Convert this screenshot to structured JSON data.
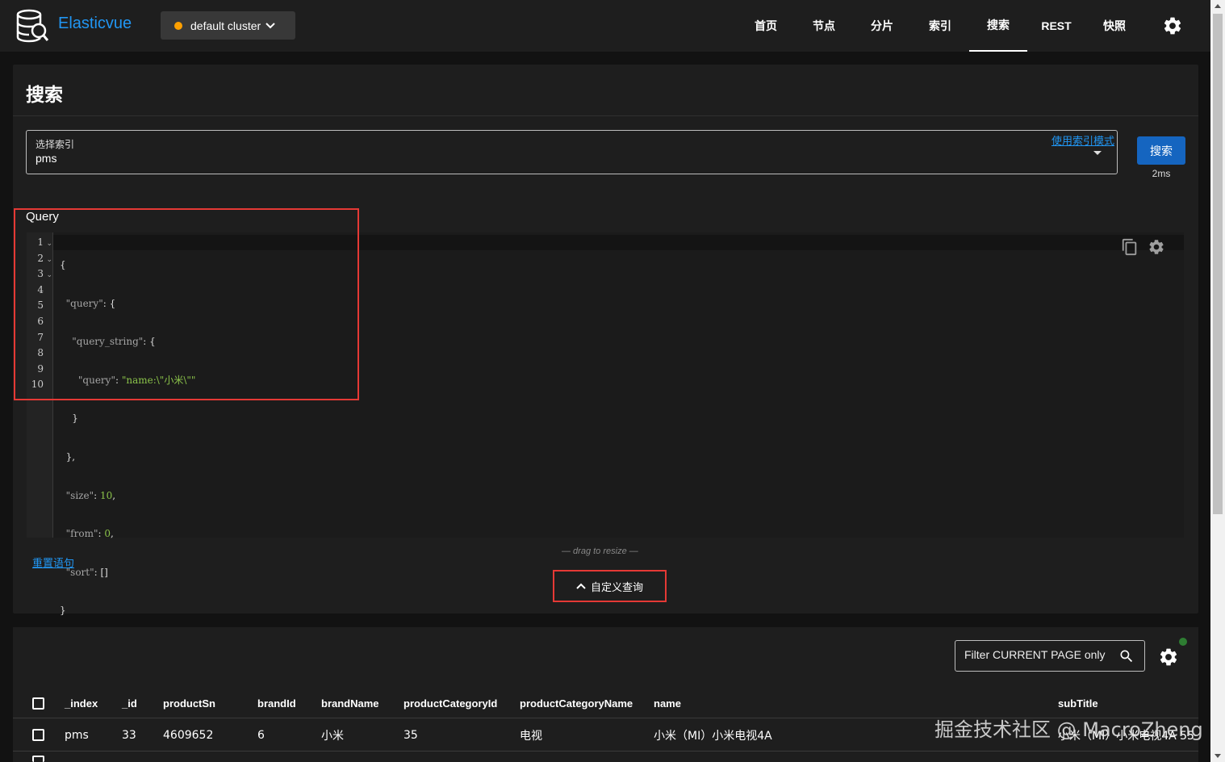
{
  "app": {
    "brand": "Elasticvue"
  },
  "cluster": {
    "label": "default cluster",
    "status_color": "#ffa000"
  },
  "nav": {
    "items": [
      {
        "label": "首页"
      },
      {
        "label": "节点"
      },
      {
        "label": "分片"
      },
      {
        "label": "索引"
      },
      {
        "label": "搜索",
        "active": true
      },
      {
        "label": "REST"
      },
      {
        "label": "快照"
      }
    ]
  },
  "search": {
    "title": "搜索",
    "index_label": "选择索引",
    "index_value": "pms",
    "index_pattern_link": "使用索引模式",
    "button": "搜索",
    "time": "2ms",
    "query_label": "Query",
    "drag_hint": "— drag to resize —",
    "reset_link": "重置语句",
    "custom_query_button": "自定义查询"
  },
  "editor": {
    "line_numbers": [
      "1",
      "2",
      "3",
      "4",
      "5",
      "6",
      "7",
      "8",
      "9",
      "10"
    ]
  },
  "results": {
    "filter_placeholder": "Filter CURRENT PAGE only",
    "columns": [
      "_index",
      "_id",
      "productSn",
      "brandId",
      "brandName",
      "productCategoryId",
      "productCategoryName",
      "name",
      "subTitle"
    ],
    "rows": [
      {
        "_index": "pms",
        "_id": "33",
        "productSn": "4609652",
        "brandId": "6",
        "brandName": "小米",
        "productCategoryId": "35",
        "productCategoryName": "电视",
        "name": "小米（MI）小米电视4A",
        "subTitle": "小米（MI）小米电视4A 55"
      }
    ]
  },
  "watermark": "掘金技术社区 @ MacroZheng",
  "colors": {
    "accent": "#2196f3",
    "primary_button": "#1565c0",
    "highlight_box": "#e53935",
    "status_ok": "#2e7d32"
  }
}
